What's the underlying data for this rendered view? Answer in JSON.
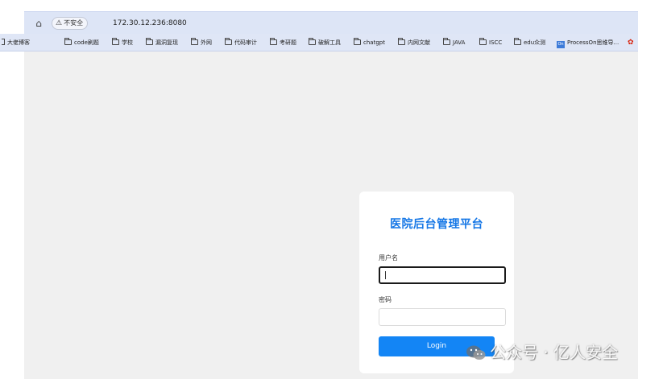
{
  "browser": {
    "security_badge": "不安全",
    "url": "172.30.12.236:8080"
  },
  "bookmarks": [
    {
      "label": "大佬博客",
      "kind": "folder"
    },
    {
      "label": "code刷题",
      "kind": "folder"
    },
    {
      "label": "学校",
      "kind": "folder"
    },
    {
      "label": "漏洞复现",
      "kind": "folder"
    },
    {
      "label": "外网",
      "kind": "folder"
    },
    {
      "label": "代码审计",
      "kind": "folder"
    },
    {
      "label": "考研题",
      "kind": "folder"
    },
    {
      "label": "破解工具",
      "kind": "folder"
    },
    {
      "label": "chatgpt",
      "kind": "folder"
    },
    {
      "label": "内网文献",
      "kind": "folder"
    },
    {
      "label": "JAVA",
      "kind": "folder"
    },
    {
      "label": "ISCC",
      "kind": "folder"
    },
    {
      "label": "edu众测",
      "kind": "folder"
    },
    {
      "label": "ProcessOn思维导...",
      "kind": "app",
      "icon_text": "On"
    }
  ],
  "login": {
    "title": "医院后台管理平台",
    "username_label": "用户名",
    "username_value": "",
    "password_label": "密码",
    "password_value": "",
    "button_label": "Login"
  },
  "watermark": {
    "text": "公众号 · 亿人安全"
  }
}
